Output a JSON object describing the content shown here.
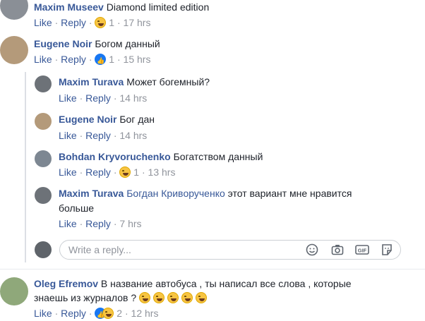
{
  "actions": {
    "like": "Like",
    "reply": "Reply",
    "sep": "·"
  },
  "comments": [
    {
      "author": "Maxim Museev",
      "text": "Diamond limited edition",
      "count": "1",
      "time": "17 hrs"
    },
    {
      "author": "Eugene Noir",
      "text": "Богом данный",
      "count": "1",
      "time": "15 hrs"
    }
  ],
  "replies": [
    {
      "author": "Maxim Turava",
      "text": "Может богемный?",
      "time": "14 hrs"
    },
    {
      "author": "Eugene Noir",
      "text": "Бог дан",
      "time": "14 hrs"
    },
    {
      "author": "Bohdan Kryvoruchenko",
      "text": "Богатством данный",
      "count": "1",
      "time": "13 hrs"
    },
    {
      "author": "Maxim Turava",
      "mention": "Богдан Кривoрученко",
      "text": "этот вариант мне нравится",
      "text2": "больше",
      "time": "7 hrs"
    }
  ],
  "reply_box": {
    "placeholder": "Write a reply..."
  },
  "last_comment": {
    "author": "Oleg Efremov",
    "text": "В название автобуса , ты написал все слова , которые",
    "text2": "знаешь из журналов ?",
    "count": "2",
    "time": "12 hrs"
  }
}
